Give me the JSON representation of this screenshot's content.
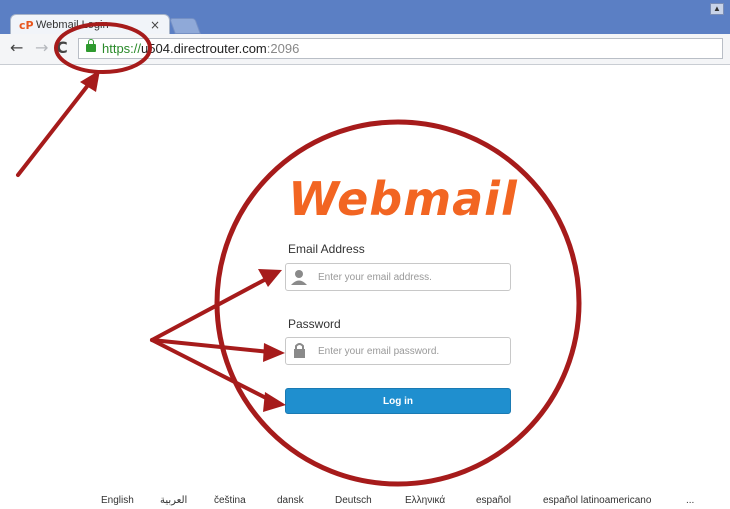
{
  "browser": {
    "tab_title": "Webmail Login",
    "tab_close": "×",
    "tab_favicon": "cP",
    "url_scheme": "https://",
    "url_host": "u504.directrouter.com",
    "url_port": ":2096",
    "nav_back": "←",
    "nav_forward": "→",
    "nav_reload": "C"
  },
  "login": {
    "logo": "Webmail",
    "email_label": "Email Address",
    "email_placeholder": "Enter your email address.",
    "password_label": "Password",
    "password_placeholder": "Enter your email password.",
    "login_button": "Log in"
  },
  "languages": [
    "English",
    "العربية",
    "čeština",
    "dansk",
    "Deutsch",
    "Ελληνικά",
    "español",
    "español latinoamericano",
    "..."
  ],
  "colors": {
    "annotation": "#a61b1b",
    "logo": "#f26522",
    "button": "#1f8fcf",
    "lock": "#2f9a2f",
    "tabbar": "#5b7fc4"
  }
}
